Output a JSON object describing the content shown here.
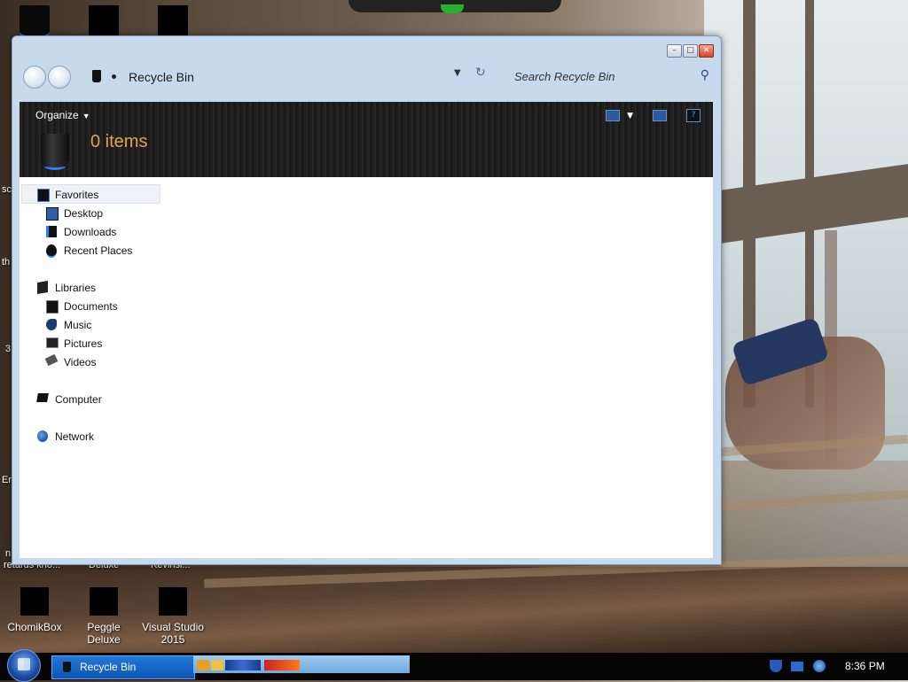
{
  "window": {
    "title_buttons": [
      "minimize",
      "maximize",
      "close"
    ],
    "address": {
      "location": "Recycle Bin",
      "search_placeholder": "Search Recycle Bin"
    },
    "command_bar": {
      "organize_label": "Organize",
      "items_count": "0 items"
    },
    "nav_pane": {
      "favorites": {
        "label": "Favorites",
        "items": [
          "Desktop",
          "Downloads",
          "Recent Places"
        ]
      },
      "libraries": {
        "label": "Libraries",
        "items": [
          "Documents",
          "Music",
          "Pictures",
          "Videos"
        ]
      },
      "computer": {
        "label": "Computer"
      },
      "network": {
        "label": "Network"
      }
    }
  },
  "desktop": {
    "icons": [
      {
        "label": "ChomikBox"
      },
      {
        "label": "Peggle Deluxe"
      },
      {
        "label": "Visual Studio 2015"
      }
    ],
    "partial_labels": {
      "left_edge": [
        "sc",
        "th",
        "3",
        "Er",
        "n"
      ],
      "row_above_icons": [
        "retards kno...",
        "Deluxe",
        "Kevinši..."
      ]
    }
  },
  "taskbar": {
    "active_task": "Recycle Bin",
    "clock": "8:36 PM"
  },
  "colors": {
    "accent_blue": "#1f7ad6",
    "items_count_orange": "#e3a24a",
    "window_frame": "#c7d9ec"
  }
}
